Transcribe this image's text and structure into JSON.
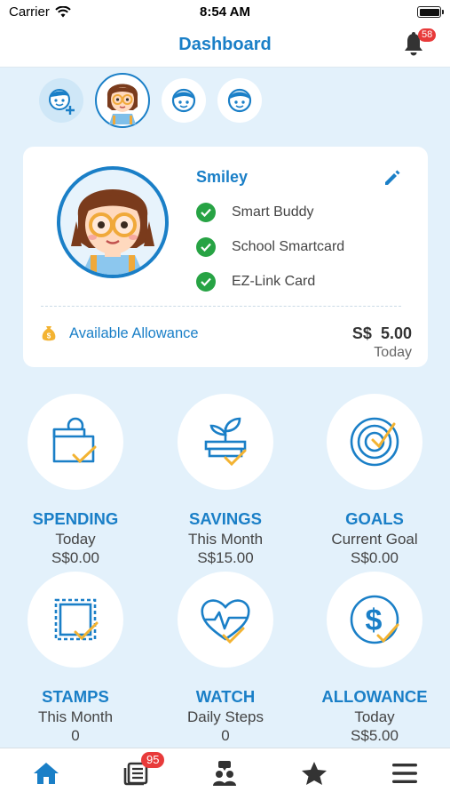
{
  "status_bar": {
    "carrier": "Carrier",
    "time": "8:54 AM"
  },
  "header": {
    "title": "Dashboard",
    "notification_count": "58"
  },
  "profile": {
    "name": "Smiley",
    "features": [
      "Smart Buddy",
      "School Smartcard",
      "EZ-Link Card"
    ],
    "allowance_label": "Available Allowance",
    "currency": "S$",
    "allowance_amount": "5.00",
    "allowance_period": "Today"
  },
  "tiles": [
    {
      "title": "SPENDING",
      "subtitle": "Today",
      "value": "S$0.00",
      "icon": "wallet-icon"
    },
    {
      "title": "SAVINGS",
      "subtitle": "This Month",
      "value": "S$15.00",
      "icon": "plant-icon"
    },
    {
      "title": "GOALS",
      "subtitle": "Current Goal",
      "value": "S$0.00",
      "icon": "target-icon"
    },
    {
      "title": "STAMPS",
      "subtitle": "This Month",
      "value": "0",
      "icon": "stamp-icon"
    },
    {
      "title": "WATCH",
      "subtitle": "Daily Steps",
      "value": "0",
      "icon": "heart-rate-icon"
    },
    {
      "title": "ALLOWANCE",
      "subtitle": "Today",
      "value": "S$5.00",
      "icon": "dollar-icon"
    }
  ],
  "tabbar": {
    "news_count": "95",
    "items": [
      "home-icon",
      "news-icon",
      "community-icon",
      "star-icon",
      "menu-icon"
    ]
  },
  "colors": {
    "primary": "#1a7fc7",
    "background": "#e3f1fb",
    "check": "#27a344",
    "badge": "#e83a3a",
    "accent": "#f3b332"
  }
}
